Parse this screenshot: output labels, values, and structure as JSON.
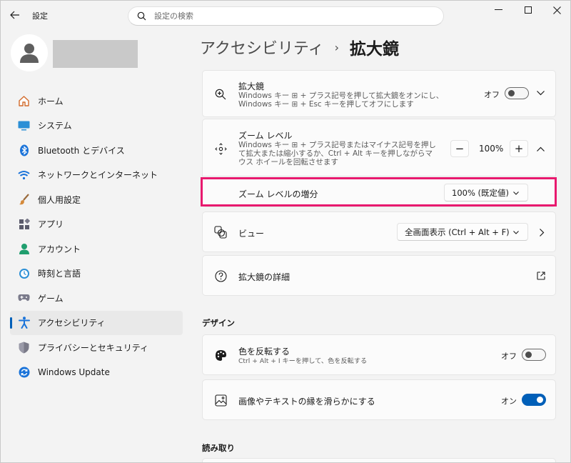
{
  "titlebar": {
    "app_title": "設定",
    "search_placeholder": "設定の検索"
  },
  "sidebar": {
    "items": [
      {
        "label": "ホーム",
        "icon": "home-icon"
      },
      {
        "label": "システム",
        "icon": "system-icon"
      },
      {
        "label": "Bluetooth とデバイス",
        "icon": "bluetooth-icon"
      },
      {
        "label": "ネットワークとインターネット",
        "icon": "wifi-icon"
      },
      {
        "label": "個人用設定",
        "icon": "brush-icon"
      },
      {
        "label": "アプリ",
        "icon": "apps-icon"
      },
      {
        "label": "アカウント",
        "icon": "account-icon"
      },
      {
        "label": "時刻と言語",
        "icon": "time-language-icon"
      },
      {
        "label": "ゲーム",
        "icon": "gamepad-icon"
      },
      {
        "label": "アクセシビリティ",
        "icon": "accessibility-icon",
        "active": true
      },
      {
        "label": "プライバシーとセキュリティ",
        "icon": "shield-icon"
      },
      {
        "label": "Windows Update",
        "icon": "update-icon"
      }
    ]
  },
  "breadcrumb": {
    "parent": "アクセシビリティ",
    "separator": "›",
    "current": "拡大鏡"
  },
  "magnifier": {
    "title": "拡大鏡",
    "desc": "Windows キー ⊞ + プラス記号を押して拡大鏡をオンにし、Windows キー ⊞ + Esc キーを押してオフにします",
    "toggle_label": "オフ",
    "toggle_on": false
  },
  "zoom_level": {
    "title": "ズーム レベル",
    "desc": "Windows キー ⊞ + プラス記号またはマイナス記号を押して拡大または縮小するか、Ctrl + Alt キーを押しながらマウス ホイールを回転させます",
    "minus": "−",
    "value": "100%",
    "plus": "+"
  },
  "zoom_increment": {
    "title": "ズーム レベルの増分",
    "selected": "100% (既定値)"
  },
  "view": {
    "title": "ビュー",
    "selected": "全画面表示 (Ctrl + Alt + F)"
  },
  "details": {
    "title": "拡大鏡の詳細"
  },
  "design_section": {
    "title": "デザイン"
  },
  "invert": {
    "title": "色を反転する",
    "desc": "Ctrl + Alt + I キーを押して、色を反転する",
    "toggle_label": "オフ",
    "toggle_on": false
  },
  "smooth": {
    "title": "画像やテキストの縁を滑らかにする",
    "toggle_label": "オン",
    "toggle_on": true
  },
  "reading_section": {
    "title": "読み取り"
  },
  "colors": {
    "accent": "#005fb8",
    "highlight": "#e8196e"
  }
}
